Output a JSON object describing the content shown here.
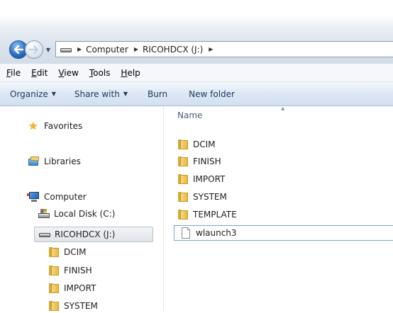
{
  "address": {
    "crumbs": [
      "Computer",
      "RICOHDCX (J:)"
    ]
  },
  "menu": [
    {
      "label": "File",
      "key": "F",
      "rest": "ile"
    },
    {
      "label": "Edit",
      "key": "E",
      "rest": "dit"
    },
    {
      "label": "View",
      "key": "V",
      "rest": "iew"
    },
    {
      "label": "Tools",
      "key": "T",
      "rest": "ools"
    },
    {
      "label": "Help",
      "key": "H",
      "rest": "elp"
    }
  ],
  "toolbar": {
    "organize": "Organize",
    "share_with": "Share with",
    "burn": "Burn",
    "new_folder": "New folder"
  },
  "sidebar": {
    "favorites": "Favorites",
    "libraries": "Libraries",
    "computer": "Computer",
    "local_disk": "Local Disk (C:)",
    "ricoh": "RICOHDCX (J:)",
    "sub": [
      "DCIM",
      "FINISH",
      "IMPORT",
      "SYSTEM"
    ]
  },
  "files": {
    "column_name": "Name",
    "folders": [
      "DCIM",
      "FINISH",
      "IMPORT",
      "SYSTEM",
      "TEMPLATE"
    ],
    "file": "wlaunch3"
  },
  "colors": {
    "toolbar_text": "#1e395b",
    "folder": "#e8b847",
    "selection_border": "#7da2ce"
  }
}
